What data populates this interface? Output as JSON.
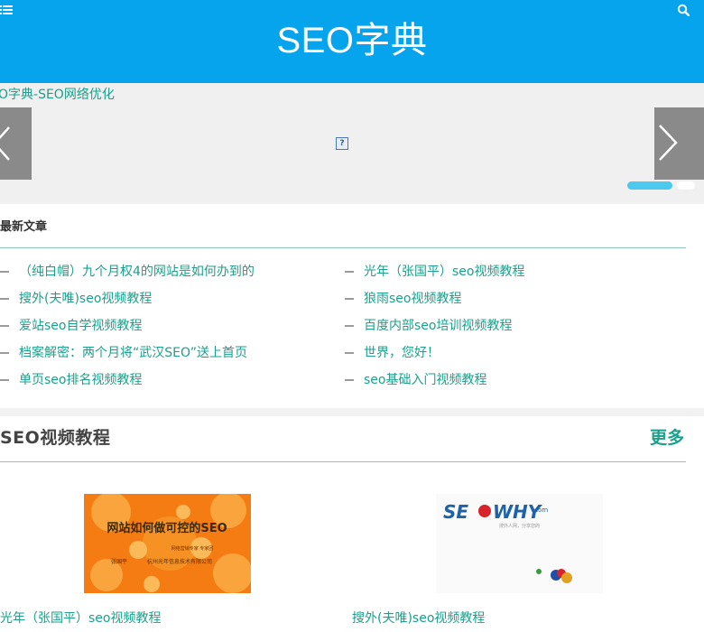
{
  "header": {
    "site_title": "SEO字典"
  },
  "slider": {
    "caption": "O字典-SEO网络优化",
    "broken_image_glyph": "?",
    "dots": 2,
    "active_dot": 1
  },
  "latest": {
    "title": "最新文章",
    "left": [
      "（纯白帽）九个月权4的网站是如何办到的",
      "搜外(夫唯)seo视频教程",
      "爱站seo自学视频教程",
      "档案解密：两个月将“武汉SEO”送上首页",
      "单页seo排名视频教程"
    ],
    "right": [
      "光年（张国平）seo视频教程",
      "狼雨seo视频教程",
      "百度内部seo培训视频教程",
      "世界，您好！",
      "seo基础入门视频教程"
    ]
  },
  "video": {
    "title": "SEO视频教程",
    "more": "更多",
    "items": [
      {
        "caption": "光年（张国平）seo视频教程",
        "thumb_heading": "网站如何做可控的SEO",
        "thumb_subtitle": "网络营销专家 专家团",
        "thumb_author": "张国平",
        "thumb_company": "杭州光年信息技术有限公司"
      },
      {
        "caption": "搜外(夫唯)seo视频教程",
        "logo_seo": "SE",
        "logo_why": "WHY",
        "logo_com": ".com",
        "logo_tagline": "搜外人网，分享您的"
      }
    ]
  },
  "colors": {
    "header_bg": "#06a4ec",
    "accent": "#1aa08b",
    "rule": "#8dc7bb"
  }
}
